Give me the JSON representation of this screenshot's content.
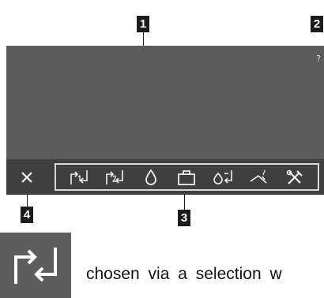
{
  "markers": [
    "1",
    "2",
    "3",
    "4"
  ],
  "screen": {
    "help_label": "?"
  },
  "toolbar": {
    "icons": [
      "swap-1-icon",
      "swap-2-icon",
      "drop-icon",
      "toolbox-icon",
      "drop-swap-icon",
      "ramp-icon",
      "tools-icon"
    ]
  },
  "close_icon": "close-icon",
  "caption": {
    "text": "chosen via a selection w"
  }
}
